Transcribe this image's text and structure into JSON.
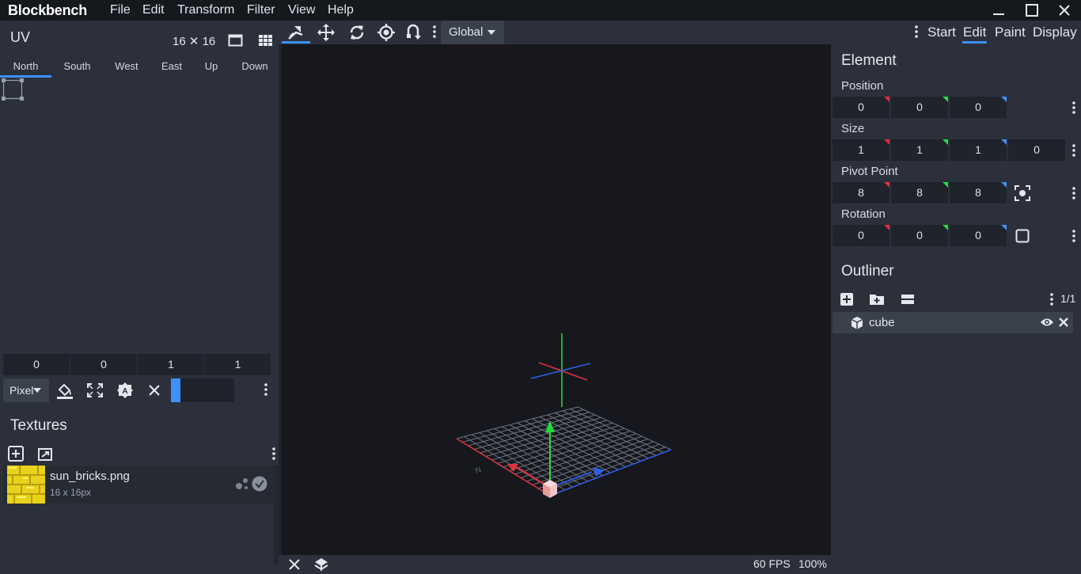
{
  "app": {
    "title": "Blockbench"
  },
  "menu": [
    "File",
    "Edit",
    "Transform",
    "Filter",
    "View",
    "Help"
  ],
  "uv": {
    "title": "UV",
    "size_label": "16 ✕ 16",
    "tabs": [
      "North",
      "South",
      "West",
      "East",
      "Up",
      "Down"
    ],
    "active_tab": "North",
    "values": [
      "0",
      "0",
      "1",
      "1"
    ],
    "mode_select": "Pixel"
  },
  "textures": {
    "title": "Textures",
    "items": [
      {
        "name": "sun_bricks.png",
        "size": "16 x 16px"
      }
    ]
  },
  "toolbar": {
    "space_select": "Global"
  },
  "modes": {
    "items": [
      "Start",
      "Edit",
      "Paint",
      "Display"
    ],
    "active": "Edit"
  },
  "element": {
    "title": "Element",
    "position_label": "Position",
    "position": [
      "0",
      "0",
      "0"
    ],
    "size_label": "Size",
    "size": [
      "1",
      "1",
      "1",
      "0"
    ],
    "pivot_label": "Pivot Point",
    "pivot": [
      "8",
      "8",
      "8"
    ],
    "rotation_label": "Rotation",
    "rotation": [
      "0",
      "0",
      "0"
    ]
  },
  "outliner": {
    "title": "Outliner",
    "page": "1/1",
    "items": [
      {
        "name": "cube"
      }
    ]
  },
  "status": {
    "fps": "60 FPS",
    "zoom": "100%"
  },
  "colors": {
    "accent": "#3e90ff",
    "x_axis": "#e0303f",
    "y_axis": "#26d93c",
    "z_axis": "#2f5fe6"
  },
  "icons": [
    "close-icon",
    "maximize-icon",
    "minimize-icon",
    "grid-icon",
    "window-icon",
    "move-icon",
    "rotate-icon",
    "pivot-icon",
    "vertex-snap-icon",
    "menu-dots-icon",
    "eye-icon",
    "cube-icon",
    "folder-add-icon",
    "add-icon",
    "collapse-icon",
    "fill-icon",
    "fullscreen-icon",
    "auto-uv-icon",
    "checkmark-icon"
  ]
}
